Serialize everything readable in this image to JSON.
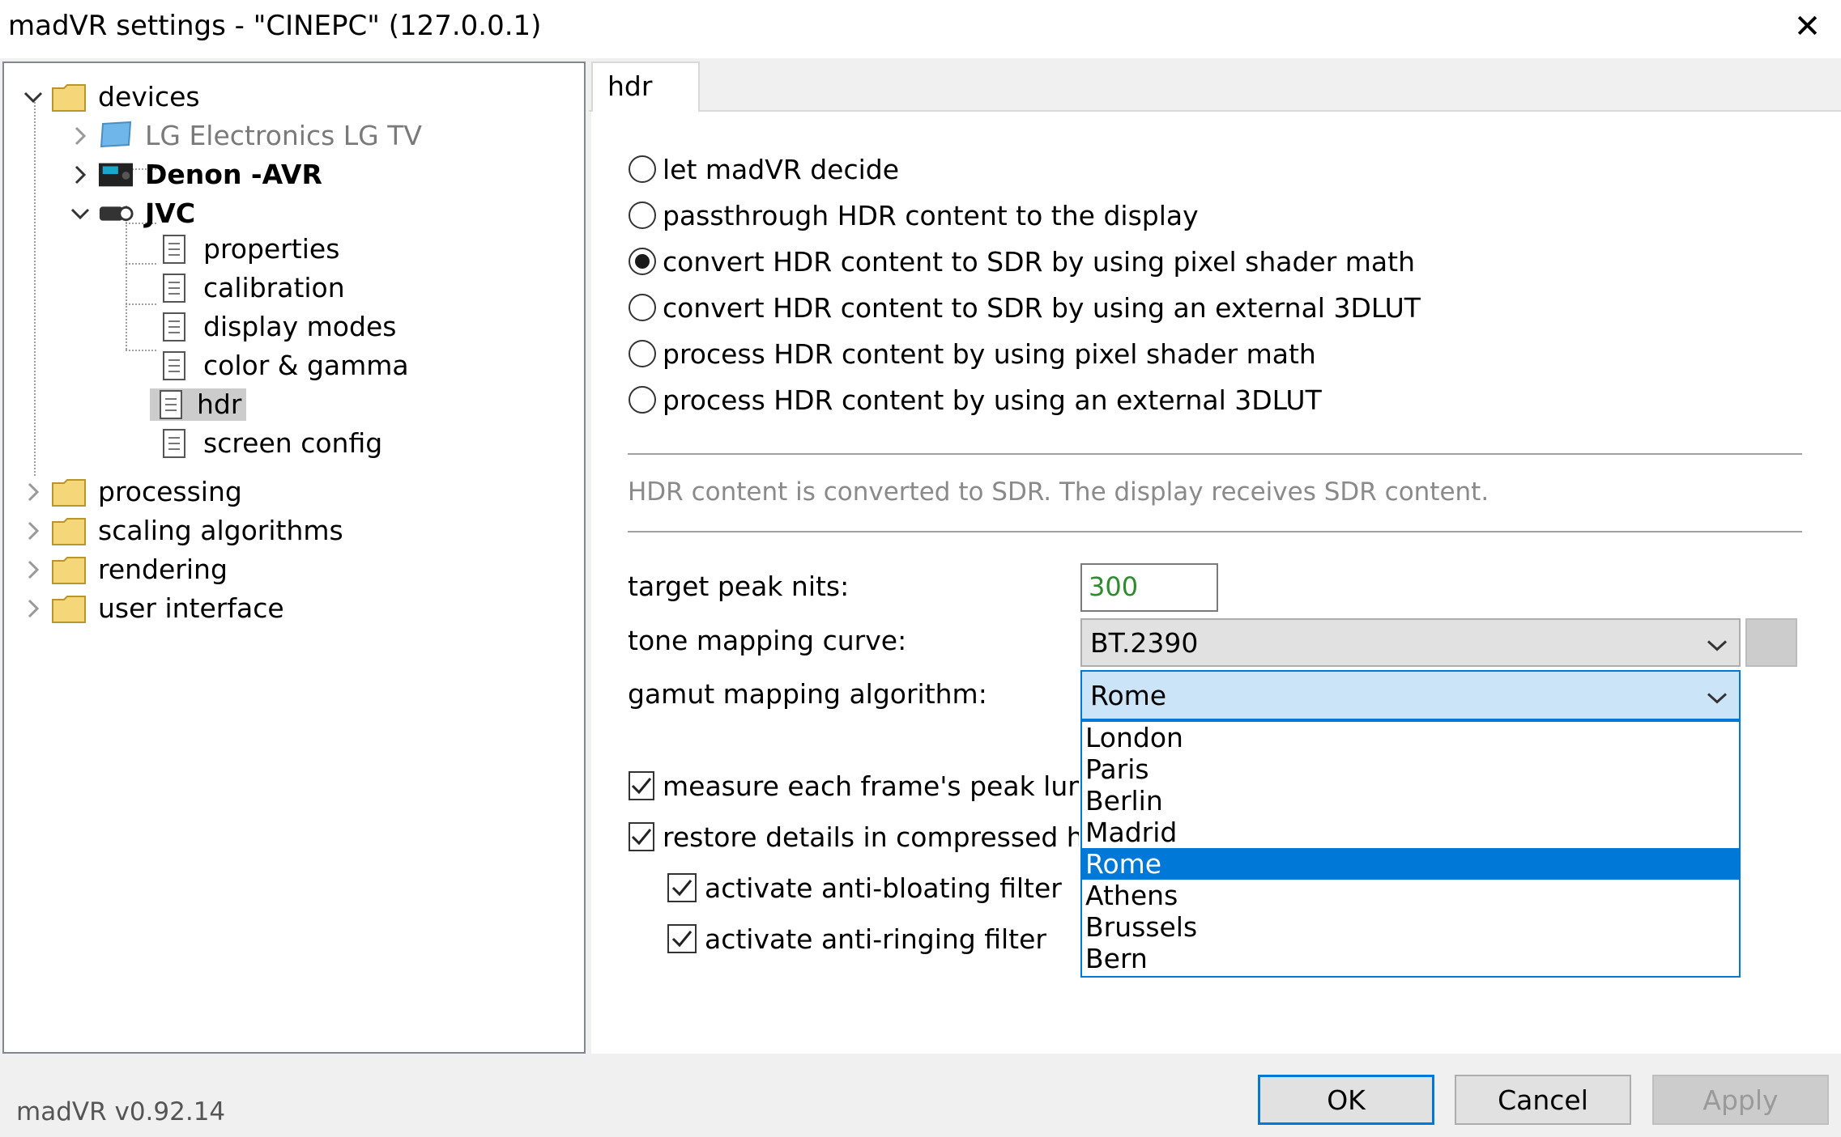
{
  "window": {
    "title": "madVR settings - \"CINEPC\" (127.0.0.1)",
    "close_glyph": "✕"
  },
  "tree": {
    "devices": "devices",
    "lg_tv": "LG Electronics LG TV",
    "denon": "Denon -AVR",
    "jvc": "JVC",
    "properties": "properties",
    "calibration": "calibration",
    "display_modes": "display modes",
    "color_gamma": "color & gamma",
    "hdr": "hdr",
    "screen_config": "screen config",
    "processing": "processing",
    "scaling": "scaling algorithms",
    "rendering": "rendering",
    "user_interface": "user interface"
  },
  "tab": {
    "label": "hdr"
  },
  "hdr_options": {
    "opt1": "let madVR decide",
    "opt2": "passthrough HDR content to the display",
    "opt3": "convert HDR content to SDR by using pixel shader math",
    "opt4": "convert HDR content to SDR by using an external 3DLUT",
    "opt5": "process HDR content by using pixel shader math",
    "opt6": "process HDR content by using an external 3DLUT",
    "selected": "opt3"
  },
  "info": "HDR content is converted to SDR. The display receives SDR content.",
  "fields": {
    "target_peak_label": "target peak nits:",
    "target_peak_value": "300",
    "tone_curve_label": "tone mapping curve:",
    "tone_curve_value": "BT.2390",
    "gamut_label": "gamut mapping algorithm:",
    "gamut_value": "Rome"
  },
  "gamut_dropdown": {
    "item0": "London",
    "item1": "Paris",
    "item2": "Berlin",
    "item3": "Madrid",
    "item4": "Rome",
    "item5": "Athens",
    "item6": "Brussels",
    "item7": "Bern",
    "highlighted": "Rome"
  },
  "checks": {
    "measure": "measure each frame's peak luminance",
    "restore": "restore details in compressed highlights",
    "anti_bloating": "activate anti-bloating filter",
    "anti_ringing": "activate anti-ringing filter"
  },
  "footer": {
    "version": "madVR v0.92.14",
    "ok": "OK",
    "cancel": "Cancel",
    "apply": "Apply"
  },
  "colors": {
    "accent": "#0078d7",
    "nits_text": "#2e8b2e",
    "dim_text": "#8a8a8a"
  }
}
